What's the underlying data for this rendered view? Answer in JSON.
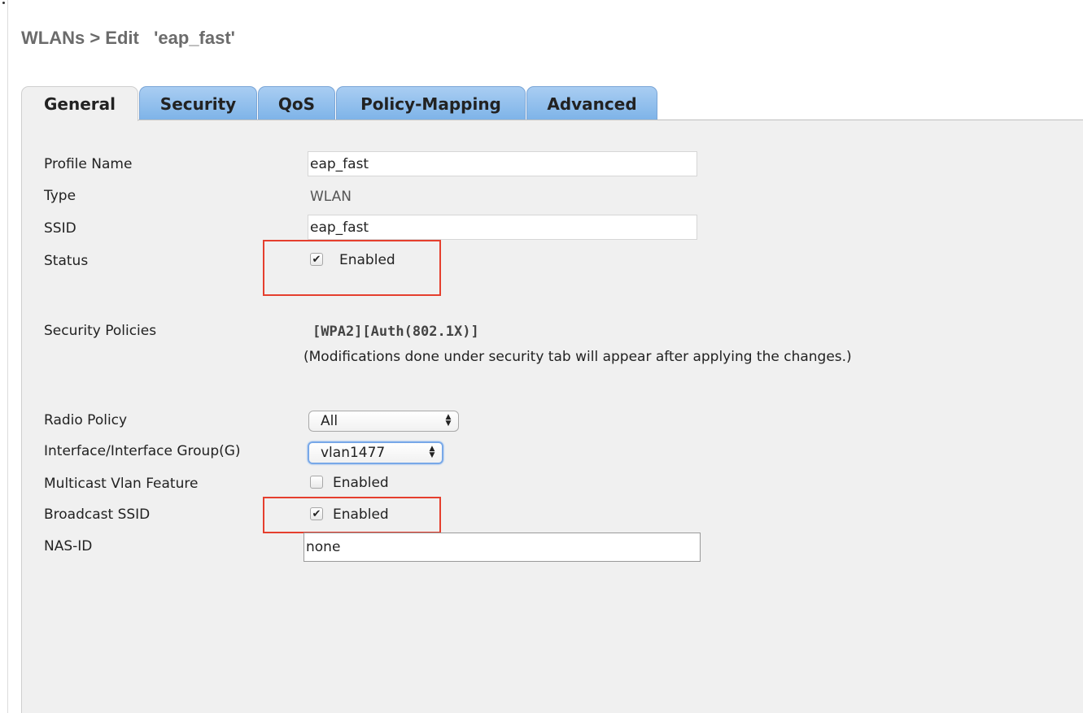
{
  "header": {
    "title": "WLANs > Edit   'eap_fast'"
  },
  "tabs": [
    {
      "label": "General",
      "active": true
    },
    {
      "label": "Security",
      "active": false
    },
    {
      "label": "QoS",
      "active": false
    },
    {
      "label": "Policy-Mapping",
      "active": false
    },
    {
      "label": "Advanced",
      "active": false
    }
  ],
  "general": {
    "profile_name": {
      "label": "Profile Name",
      "value": "eap_fast"
    },
    "type": {
      "label": "Type",
      "value": "WLAN"
    },
    "ssid": {
      "label": "SSID",
      "value": "eap_fast"
    },
    "status": {
      "label": "Status",
      "checked": true,
      "option_label": "Enabled"
    },
    "security_policies": {
      "label": "Security Policies",
      "value": "[WPA2][Auth(802.1X)]",
      "note": "(Modifications done under security tab will appear after applying the changes.)"
    },
    "radio_policy": {
      "label": "Radio Policy",
      "selected": "All"
    },
    "interface_group": {
      "label": "Interface/Interface Group(G)",
      "selected": "vlan1477"
    },
    "multicast_vlan": {
      "label": "Multicast Vlan Feature",
      "checked": false,
      "option_label": "Enabled"
    },
    "broadcast_ssid": {
      "label": "Broadcast SSID",
      "checked": true,
      "option_label": "Enabled"
    },
    "nas_id": {
      "label": "NAS-ID",
      "value": "none"
    }
  },
  "colors": {
    "highlight": "#e53f2e",
    "tab_inactive": "#8fc0ee",
    "panel": "#f0f0f0",
    "title": "#6b6b6b"
  },
  "icons": {
    "checkmark": "check-icon",
    "select_arrows": "updown-arrows-icon"
  }
}
